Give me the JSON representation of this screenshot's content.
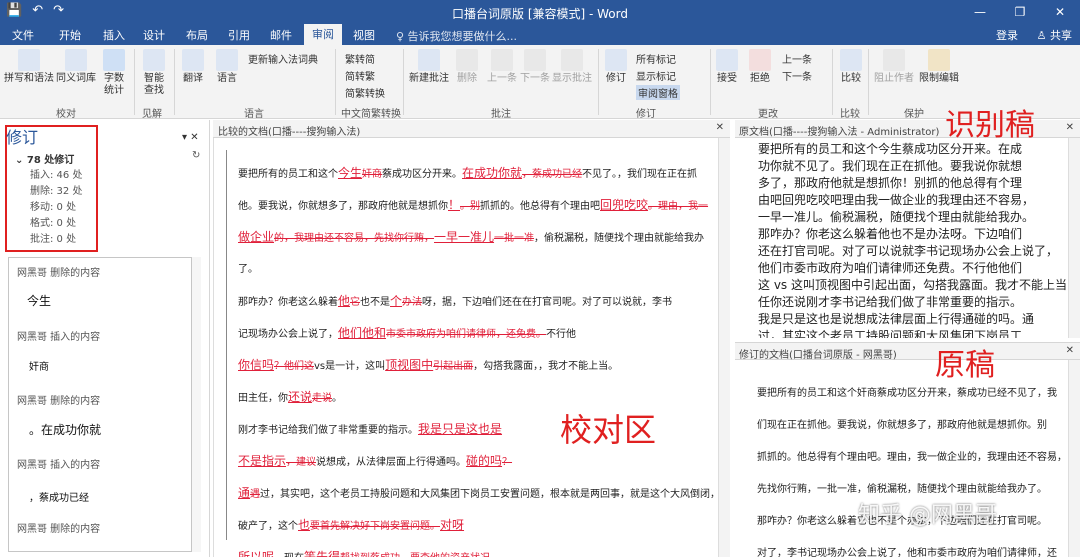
{
  "window": {
    "title": "口播台词原版 [兼容模式] - Word",
    "minimize": "—",
    "restore": "❐",
    "close": "✕"
  },
  "quick_access": {
    "save": "💾",
    "undo": "↶",
    "redo": "↷"
  },
  "tabs": [
    "文件",
    "开始",
    "插入",
    "设计",
    "布局",
    "引用",
    "邮件",
    "审阅",
    "视图"
  ],
  "active_tab": "审阅",
  "tell_me": "♀ 告诉我您想要做什么...",
  "signin": "登录",
  "share": "♙ 共享",
  "ribbon": {
    "proofing": {
      "spell": "拼写和语法",
      "thesaurus": "同义词库",
      "wordcount_top": "字数",
      "wordcount_bot": "统计",
      "group": "校对"
    },
    "insights": {
      "smart_top": "智能",
      "smart_bot": "查找",
      "group": "见解"
    },
    "language": {
      "translate": "翻译",
      "language": "语言",
      "update_ime": "更新输入法词典",
      "group": "语言"
    },
    "chinese": {
      "to_trad": "繁转简",
      "to_simp": "简转繁",
      "convert": "简繁转换",
      "group": "中文简繁转换"
    },
    "comments": {
      "new": "新建批注",
      "delete": "删除",
      "prev": "上一条",
      "next": "下一条",
      "show": "显示批注",
      "group": "批注"
    },
    "tracking": {
      "track": "修订",
      "all_markup": "所有标记",
      "show_markup": "显示标记",
      "pane": "审阅窗格",
      "group": "修订"
    },
    "changes": {
      "accept": "接受",
      "reject": "拒绝",
      "prev": "上一条",
      "next": "下一条",
      "group": "更改"
    },
    "compare": {
      "compare": "比较",
      "group": "比较"
    },
    "protect": {
      "block": "阻止作者",
      "restrict": "限制编辑",
      "group": "保护"
    }
  },
  "revisions_pane": {
    "title": "修订",
    "count": "78 处修订",
    "insert": "插入: 46 处",
    "delete": "删除: 32 处",
    "move": "移动: 0 处",
    "format": "格式: 0 处",
    "comment": "批注: 0 处",
    "items": [
      {
        "head": "网黑哥 删除的内容",
        "text": "今生"
      },
      {
        "head": "网黑哥 插入的内容",
        "text": "奸商"
      },
      {
        "head": "网黑哥 删除的内容",
        "text": "。在成功你就"
      },
      {
        "head": "网黑哥 插入的内容",
        "text": "，蔡成功已经"
      },
      {
        "head": "网黑哥 删除的内容",
        "text": ""
      }
    ]
  },
  "center": {
    "header": "比较的文档(口播----搜狗输入法)",
    "close": "✕",
    "overlay": "校对区",
    "lines": [
      {
        "a": "要把所有的员工和这个",
        "i": "今生",
        "d": "奸商",
        "b": "蔡成功区分开来。",
        "i2": "在成功你就",
        "d2": "，蔡成功已经",
        "c": "不见了。，我们现在正在抓"
      },
      {
        "a": "他。要我说，你就想多了，那政府他就是想抓你",
        "i": "！",
        "d": "。别",
        "b": "抓抓的。他总得有个理由吧",
        "i2": "回兜吃咬",
        "d2": "。理由，我一",
        "c": ""
      },
      {
        "a": "",
        "i": "做企业",
        "d": "的，我理由还不容易，先找你行贿，",
        "i2": "一早一准儿",
        "d2": "一批一准",
        "c": "，偷税漏税，随便找个理由就能给我办"
      },
      {
        "a": "了。",
        "i": "",
        "d": "",
        "b": "",
        "i2": "",
        "d2": "",
        "c": ""
      },
      {
        "a": "那咋办？你老这么躲着",
        "i": "他",
        "d": "它",
        "b": "也不是",
        "i2": "个",
        "d2": "办法",
        "c": "呀，据，下边咱们还在在打官司呢。对了可以说就，李书"
      },
      {
        "a": "记",
        "i": "",
        "d": "",
        "b": "现场办公会上说了，",
        "i2": "他们他和",
        "d2": "市委市政府为咱们请律师，还免费。",
        "c": "不行他"
      },
      {
        "a": "",
        "i": "你信吗",
        "d": "？他们这",
        "b": "vs是一计，这叫",
        "i2": "顶视图中",
        "d2": "引起出面",
        "c": "，勾搭我露面，，我才不能上当。"
      },
      {
        "a": "田主任，你",
        "i": "还说",
        "d": "走说",
        "b": "。",
        "i2": "",
        "d2": "",
        "c": ""
      },
      {
        "a": "刚才李书记给我们做了非常重要的指示。",
        "i": "我是只是这也是",
        "d": "",
        "b": "",
        "i2": "",
        "d2": "",
        "c": ""
      },
      {
        "a": "",
        "i": "不是指示",
        "d": "，建议",
        "b": "说想成，从法律层面上行得通吗。",
        "i2": "碰的吗",
        "d2": "？",
        "c": ""
      },
      {
        "a": "",
        "i": "通",
        "d": "遇",
        "b": "过，其实吧，这个老员工持股问题和大风集团下岗员工安置问题，根本就是两回事，就是这个大风倒闭，",
        "i2": "",
        "d2": "",
        "c": ""
      },
      {
        "a": "破产了，这个",
        "i": "也",
        "d": "要首先解决好下岗安置问题。",
        "b": "",
        "i2": "对呀",
        "d2": "",
        "c": ""
      },
      {
        "a": "",
        "i": "所以呢",
        "d": "",
        "b": "，现在",
        "i2": "等先得",
        "d2": "帮找到蔡成功，要查他的资产状况。",
        "c": ""
      }
    ]
  },
  "right_top": {
    "header": "原文档(口播----搜狗输入法 - Administrator)",
    "close": "✕",
    "overlay": "识别稿",
    "lines": [
      "要把所有的员工和这个今生蔡成功区分开来。在成",
      "功你就不见了。我们现在正在抓他。要我说你就想",
      "多了，那政府他就是想抓你！别抓的他总得有个理",
      "由吧回兜吃咬吧理由我一做企业的我理由还不容易，",
      "一早一准儿。偷税漏税，随便找个理由就能给我办。",
      "那咋办？你老这么躲着他也不是办法呀。下边咱们",
      "还在打官司呢。对了可以说就李书记现场办公会上说了，",
      "他们市委市政府为咱们请律师还免费。不行他他们",
      "这 vs 这叫顶视图中引起出面，勾搭我露面。我才不能上当田主",
      "任你还说刚才李书记给我们做了非常重要的指示。",
      "我是只是这也是说想成法律层面上行得通碰的吗。通",
      "过，其实这个老员工持股问题和大风集团下岗员工"
    ]
  },
  "right_bot": {
    "header": "修订的文档(口播台词原版 - 网黑哥)",
    "close": "✕",
    "overlay": "原稿",
    "lines": [
      "要把所有的员工和这个奸商蔡成功区分开来，蔡成功已经不见了，我",
      "们现在正在抓他。要我说，你就想多了，那政府他就是想抓你。别",
      "抓抓的。他总得有个理由吧。理由，我一做企业的，我理由还不容易，",
      "先找你行贿，一批一准，偷税漏税，随便找个理由就能给我办了。",
      "那咋办？你老这么躲着它也不是个办法，下边咱们还在打官司呢。",
      "对了，李书记现场办公会上说了，他和市委市政府为咱们请律师，还"
    ]
  },
  "watermark": "知乎 @网黑哥"
}
